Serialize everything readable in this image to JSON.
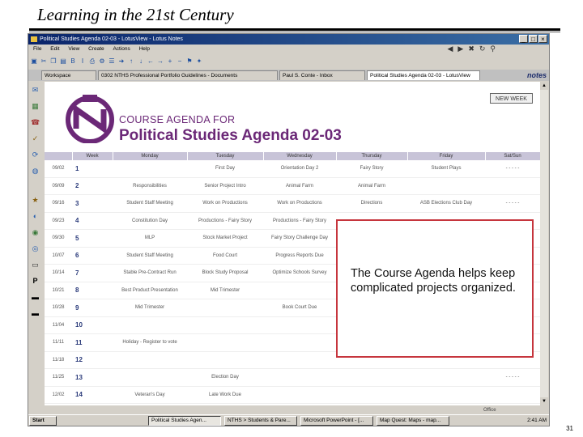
{
  "slide": {
    "title": "Learning in the 21st Century",
    "page_number": "31"
  },
  "window": {
    "title": "Political Studies Agenda 02-03 - LotusView - Lotus Notes",
    "controls": [
      "_",
      "□",
      "×"
    ]
  },
  "menu": [
    "File",
    "Edit",
    "View",
    "Create",
    "Actions",
    "Help"
  ],
  "toolbar_icons": [
    "open-icon",
    "cut-icon",
    "copy-icon",
    "paste-icon",
    "bold-icon",
    "italic-icon",
    "print-icon",
    "tools-icon",
    "list-icon",
    "arrow-icon"
  ],
  "tabs": [
    {
      "label": "Workspace"
    },
    {
      "label": "0302 NTHS Professional Portfolio Guidelines - Documents"
    },
    {
      "label": "Paul S. Conte - Inbox"
    },
    {
      "label": "Political Studies Agenda 02-03 - LotusView",
      "active": true
    }
  ],
  "brand": "notes",
  "agenda": {
    "heading_small": "COURSE AGENDA FOR",
    "heading_large": "Political Studies Agenda 02-03",
    "new_week_button": "NEW WEEK",
    "columns": [
      "",
      "Week",
      "Monday",
      "Tuesday",
      "Wednesday",
      "Thursday",
      "Friday",
      "Sat/Sun"
    ],
    "rows": [
      {
        "date": "09/02",
        "week": "1",
        "cells": [
          "",
          "First Day",
          "Orientation Day 2",
          "Fairy Story",
          "Student Plays",
          "- - - - -"
        ]
      },
      {
        "date": "09/09",
        "week": "2",
        "cells": [
          "Responsibilities",
          "Senior Project Intro",
          "Animal Farm",
          "Animal Farm",
          "",
          ""
        ]
      },
      {
        "date": "09/16",
        "week": "3",
        "cells": [
          "Student Staff Meeting",
          "Work on Productions",
          "Work on Productions",
          "Directions",
          "ASB Elections Club Day",
          "- - - - -"
        ]
      },
      {
        "date": "09/23",
        "week": "4",
        "cells": [
          "Constitution Day",
          "Productions - Fairy Story",
          "Productions - Fairy Story",
          "",
          "",
          ""
        ]
      },
      {
        "date": "09/30",
        "week": "5",
        "cells": [
          "MLP",
          "Stock Market Project",
          "Fairy Story Challenge Day",
          "",
          "",
          ""
        ]
      },
      {
        "date": "10/07",
        "week": "6",
        "cells": [
          "Student Staff Meeting",
          "Food Court",
          "Progress Reports Due",
          "",
          "",
          ""
        ]
      },
      {
        "date": "10/14",
        "week": "7",
        "cells": [
          "Stable Pre-Contract Run",
          "Block Study Proposal",
          "Optimize Schools Survey",
          "",
          "",
          ""
        ]
      },
      {
        "date": "10/21",
        "week": "8",
        "cells": [
          "Best Product Presentation",
          "Mid Trimester",
          "",
          "",
          "",
          ""
        ]
      },
      {
        "date": "10/28",
        "week": "9",
        "cells": [
          "Mid Trimester",
          "",
          "Book Court Due",
          "",
          "",
          ""
        ]
      },
      {
        "date": "11/04",
        "week": "10",
        "cells": [
          "",
          "",
          "",
          "",
          "",
          ""
        ]
      },
      {
        "date": "11/11",
        "week": "11",
        "cells": [
          "Holiday - Register to vote",
          "",
          "",
          "",
          "",
          ""
        ]
      },
      {
        "date": "11/18",
        "week": "12",
        "cells": [
          "",
          "",
          "",
          "",
          "",
          ""
        ]
      },
      {
        "date": "11/25",
        "week": "13",
        "cells": [
          "",
          "Election Day",
          "",
          "",
          "",
          "- - - - -"
        ]
      },
      {
        "date": "12/02",
        "week": "14",
        "cells": [
          "Veteran's Day",
          "Late Work Due",
          "",
          "",
          "",
          ""
        ]
      }
    ]
  },
  "callout": {
    "text": "The Course Agenda helps keep complicated projects organized."
  },
  "status": {
    "right_text": "Office"
  },
  "taskbar": {
    "start": "Start",
    "buttons": [
      {
        "label": "Political Studies Agen...",
        "active": true
      },
      {
        "label": "NTHS > Students & Pare..."
      },
      {
        "label": "Microsoft PowerPoint - [..."
      },
      {
        "label": "Map Quest: Maps - map..."
      }
    ],
    "clock": "2:41 AM"
  },
  "colors": {
    "accent_purple": "#6b2877",
    "callout_border": "#c6353d",
    "header_row": "#c8c4d8",
    "titlebar": "#0a246a"
  }
}
